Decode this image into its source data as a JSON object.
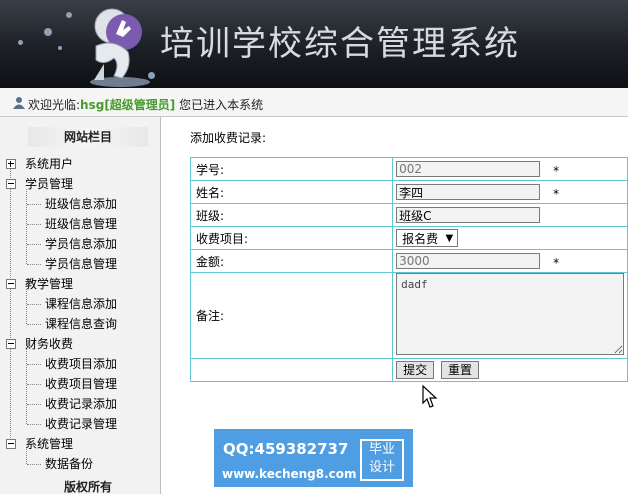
{
  "header": {
    "system_title": "培训学校综合管理系统"
  },
  "welcome": {
    "prefix": "欢迎光临:",
    "username": "hsg[超级管理员]",
    "suffix": "您已进入本系统"
  },
  "sidebar": {
    "title": "网站栏目",
    "groups": [
      {
        "label": "系统用户",
        "expanded": false,
        "items": []
      },
      {
        "label": "学员管理",
        "expanded": true,
        "items": [
          "班级信息添加",
          "班级信息管理",
          "学员信息添加",
          "学员信息管理"
        ]
      },
      {
        "label": "教学管理",
        "expanded": true,
        "items": [
          "课程信息添加",
          "课程信息查询"
        ]
      },
      {
        "label": "财务收费",
        "expanded": true,
        "items": [
          "收费项目添加",
          "收费项目管理",
          "收费记录添加",
          "收费记录管理"
        ]
      },
      {
        "label": "系统管理",
        "expanded": true,
        "items": [
          "数据备份"
        ]
      }
    ],
    "footer": "版权所有"
  },
  "main": {
    "title": "添加收费记录:",
    "fields": {
      "student_id": {
        "label": "学号:",
        "value": "002",
        "required": "*"
      },
      "name": {
        "label": "姓名:",
        "value": "李四",
        "required": "*"
      },
      "class": {
        "label": "班级:",
        "value": "班级C"
      },
      "fee_item": {
        "label": "收费项目:",
        "value": "报名费"
      },
      "amount": {
        "label": "金额:",
        "value": "3000",
        "required": "*"
      },
      "remark": {
        "label": "备注:",
        "value": "dadf"
      }
    },
    "buttons": {
      "submit": "提交",
      "reset": "重置"
    }
  },
  "watermark": {
    "qq": "QQ:459382737",
    "site": "www.kecheng8.com",
    "line1": "毕业",
    "line2": "设计"
  }
}
